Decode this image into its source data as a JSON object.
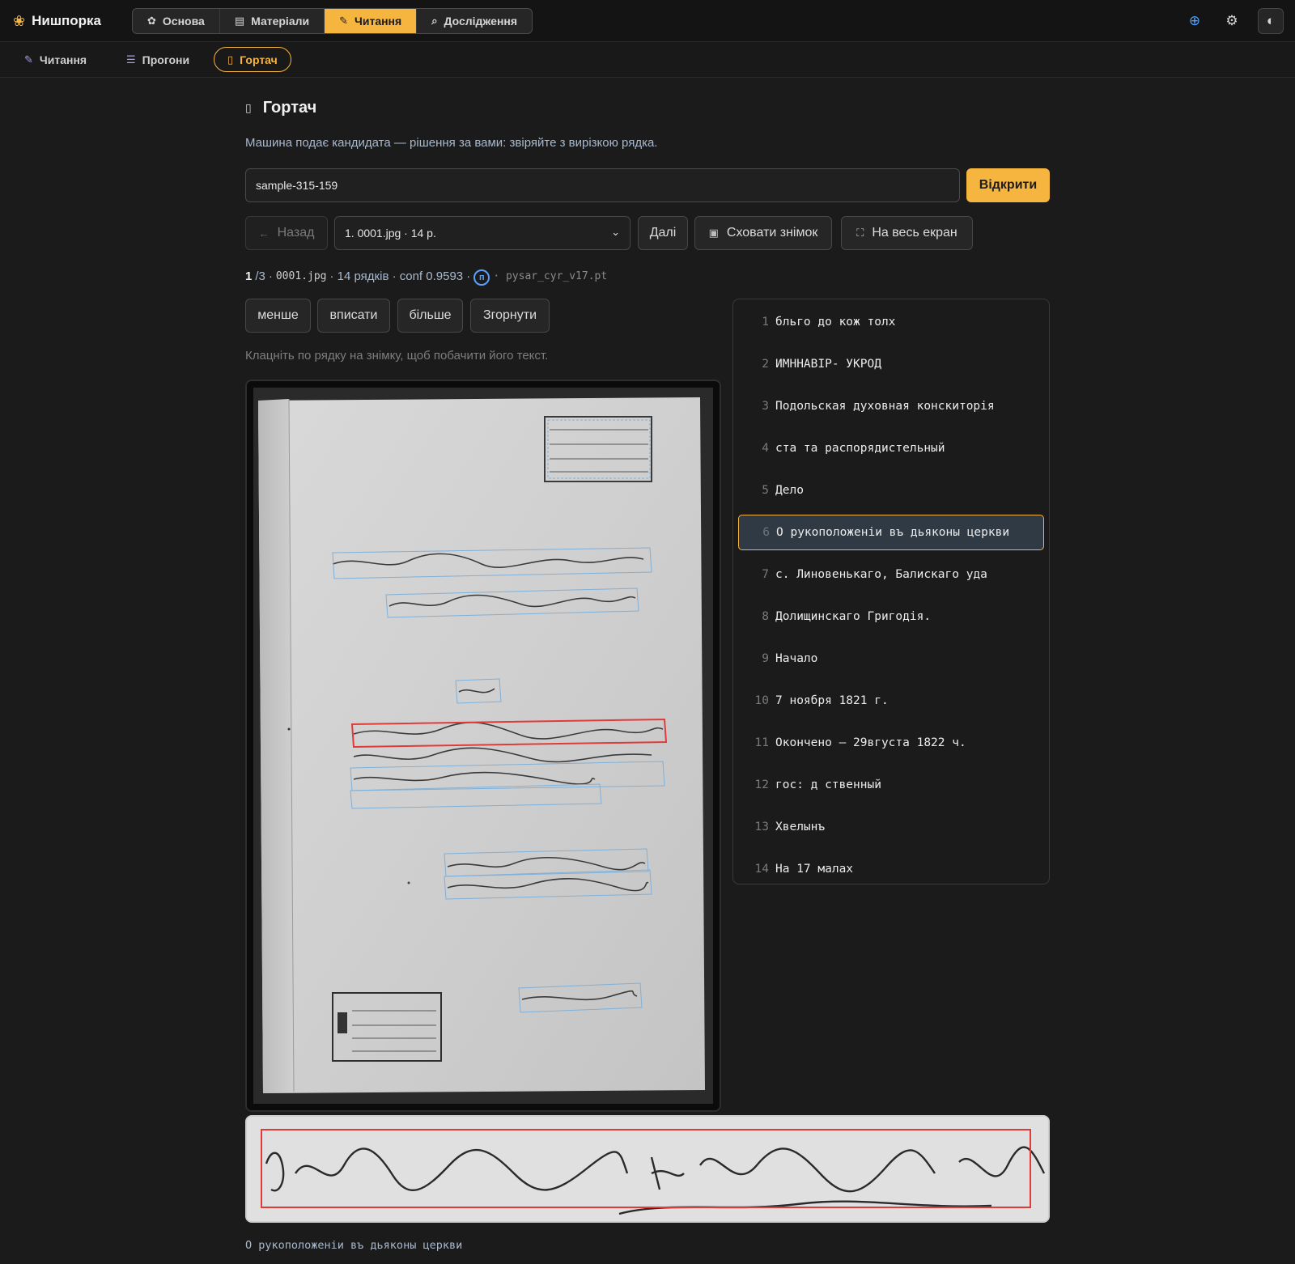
{
  "app": {
    "brand": "Нишпорка"
  },
  "main_tabs": [
    {
      "label": "Основа",
      "icon": "paw-icon"
    },
    {
      "label": "Матеріали",
      "icon": "archive-icon"
    },
    {
      "label": "Читання",
      "icon": "feather-icon",
      "active": true
    },
    {
      "label": "Дослідження",
      "icon": "search-icon"
    }
  ],
  "sub_tabs": [
    {
      "label": "Читання",
      "icon": "feather-icon"
    },
    {
      "label": "Прогони",
      "icon": "list-icon"
    },
    {
      "label": "Гортач",
      "icon": "file-icon",
      "active": true
    }
  ],
  "page": {
    "title": "Гортач",
    "subtitle": "Машина подає кандидата — рішення за вами: звіряйте з вирізкою рядка.",
    "open_button": "Відкрити"
  },
  "search": {
    "value": "sample-315-159",
    "placeholder": ""
  },
  "nav": {
    "back": "Назад",
    "select_value": "1. 0001.jpg · 14 р.",
    "next": "Далі",
    "hide_image": "Сховати знімок",
    "fullscreen": "На весь екран"
  },
  "meta": {
    "current": "1",
    "total": "/3",
    "sep1": "·",
    "file": "0001.jpg",
    "lines": "· 14 рядків · conf 0.9593 ·",
    "model_badge": "п",
    "model": "· pysar_cyr_v17.pt"
  },
  "zoom": {
    "less": "менше",
    "fit": "вписати",
    "more": "більше",
    "collapse": "Згорнути"
  },
  "hint": "Клацніть по рядку на знімку, щоб побачити його текст.",
  "lines": [
    {
      "n": "1",
      "text": "бльго до кож толх"
    },
    {
      "n": "2",
      "text": "ИМННАВІР- УКРОД"
    },
    {
      "n": "3",
      "text": "Подольская духовная конскиторія"
    },
    {
      "n": "4",
      "text": "ста та распорядистельный"
    },
    {
      "n": "5",
      "text": "Дело"
    },
    {
      "n": "6",
      "text": "О рукоположенiи въ дьяконы церкви",
      "active": true
    },
    {
      "n": "7",
      "text": "с. Линовенькаго, Балискаго уда"
    },
    {
      "n": "8",
      "text": "Долищинскаго Григодія."
    },
    {
      "n": "9",
      "text": "Начало"
    },
    {
      "n": "10",
      "text": "7 ноября 1821 г."
    },
    {
      "n": "11",
      "text": "Окончено – 29вгуста 1822 ч."
    },
    {
      "n": "12",
      "text": "гос: д ственный"
    },
    {
      "n": "13",
      "text": "Хвелынъ"
    },
    {
      "n": "14",
      "text": "На 17 малах"
    }
  ],
  "selected_line_text": "О рукоположенiи въ дьяконы церкви",
  "colors": {
    "accent": "#f6b53f",
    "highlight": "#e03b3b",
    "line_box": "#7fb0d8"
  }
}
